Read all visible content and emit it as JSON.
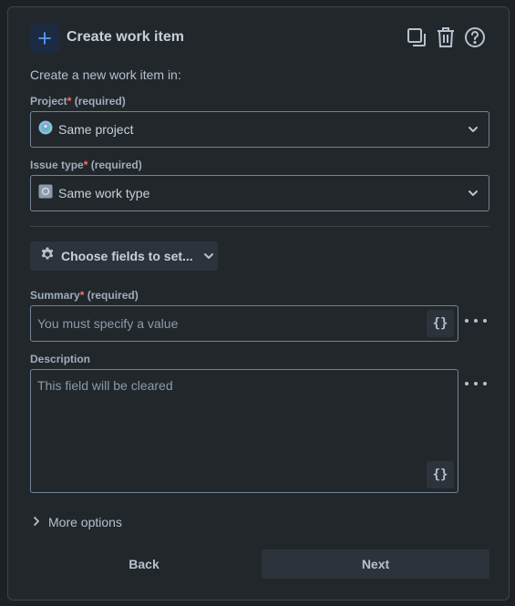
{
  "header": {
    "title": "Create work item",
    "icons": [
      "plus-icon",
      "copy-icon",
      "trash-icon",
      "help-icon"
    ]
  },
  "intro": "Create a new work item in:",
  "project": {
    "label": "Project",
    "required_mark": "*",
    "required_text": "(required)",
    "value": "Same project"
  },
  "issue_type": {
    "label": "Issue type",
    "required_mark": "*",
    "required_text": "(required)",
    "value": "Same work type"
  },
  "fields_button": {
    "label": "Choose fields to set..."
  },
  "summary": {
    "label": "Summary",
    "required_mark": "*",
    "required_text": "(required)",
    "placeholder": "You must specify a value",
    "brace": "{}"
  },
  "description": {
    "label": "Description",
    "placeholder": "This field will be cleared",
    "brace": "{}"
  },
  "more_options": "More options",
  "footer": {
    "back": "Back",
    "next": "Next"
  },
  "colors": {
    "background": "#1d2125",
    "panel": "#22272b",
    "accent": "#579dff",
    "required": "#f87168",
    "button": "#2c333a"
  }
}
